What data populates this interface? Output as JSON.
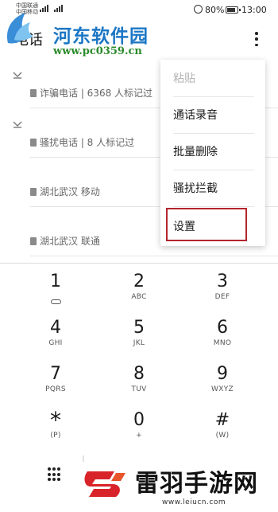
{
  "status_bar": {
    "carrier_lines": [
      "中国联通",
      "中国移动"
    ],
    "network_labels": [
      "4G",
      "4G"
    ],
    "battery_percent": "80%",
    "battery_level": 0.8,
    "time": "13:00"
  },
  "header": {
    "title": "电话",
    "more_icon": "more-vertical-icon"
  },
  "watermark_top": {
    "name": "河东软件园",
    "url": "www.pc0359.cn"
  },
  "call_log": [
    {
      "name": "",
      "meta": "诈骗电话 | 6368 人标记过",
      "missed": false
    },
    {
      "name": "",
      "meta": "骚扰电话 | 8 人标记过",
      "missed": true
    },
    {
      "name": "",
      "meta": "湖北武汉 移动",
      "missed": false
    },
    {
      "name": "",
      "meta": "湖北武汉 联通",
      "missed": false
    }
  ],
  "menu": {
    "items": [
      {
        "label": "粘贴",
        "disabled": true
      },
      {
        "label": "通话录音",
        "disabled": false
      },
      {
        "label": "批量删除",
        "disabled": false
      },
      {
        "label": "骚扰拦截",
        "disabled": false
      },
      {
        "label": "设置",
        "disabled": false,
        "highlighted": true
      }
    ]
  },
  "dialpad": {
    "keys": [
      {
        "digit": "1",
        "letters": "",
        "voicemail": true
      },
      {
        "digit": "2",
        "letters": "ABC"
      },
      {
        "digit": "3",
        "letters": "DEF"
      },
      {
        "digit": "4",
        "letters": "GHI"
      },
      {
        "digit": "5",
        "letters": "JKL"
      },
      {
        "digit": "6",
        "letters": "MNO"
      },
      {
        "digit": "7",
        "letters": "PQRS"
      },
      {
        "digit": "8",
        "letters": "TUV"
      },
      {
        "digit": "9",
        "letters": "WXYZ"
      },
      {
        "digit": "*",
        "letters": "(P)"
      },
      {
        "digit": "0",
        "letters": "+"
      },
      {
        "digit": "#",
        "letters": "(W)"
      }
    ]
  },
  "watermark_bottom": {
    "name": "雷羽手游网",
    "url": "www.leiucn.com"
  },
  "colors": {
    "highlight_border": "#b4262d",
    "watermark_blue": "#1c77c5",
    "watermark_green": "#2a8a2a",
    "missed_red": "#dd4444"
  }
}
